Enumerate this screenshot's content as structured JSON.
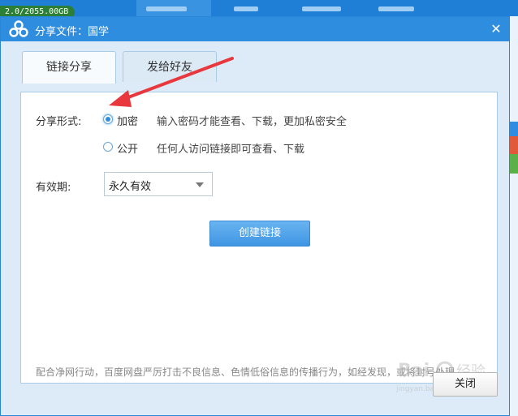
{
  "background": {
    "storage_text": "2.0/2055.00GB"
  },
  "dialog": {
    "title": "分享文件：国学",
    "tabs": [
      {
        "label": "链接分享",
        "active": true
      },
      {
        "label": "发给好友",
        "active": false
      }
    ],
    "share_form_label": "分享形式:",
    "options": [
      {
        "label": "加密",
        "description": "输入密码才能查看、下载，更加私密安全",
        "selected": true
      },
      {
        "label": "公开",
        "description": "任何人访问链接即可查看、下载",
        "selected": false
      }
    ],
    "validity_label": "有效期:",
    "validity_value": "永久有效",
    "create_button": "创建链接",
    "notice": "配合净网行动，百度网盘严厉打击不良信息、色情低俗信息的传播行为，如经发现，或将封号处理。",
    "close_button": "关闭"
  },
  "watermark": {
    "line1": "Bai 经验",
    "line2": "jingyan.baidu.com"
  },
  "colors": {
    "titlebar": "#2f8de0",
    "accent": "#3f95e3",
    "annotation_arrow": "#e8383d"
  }
}
